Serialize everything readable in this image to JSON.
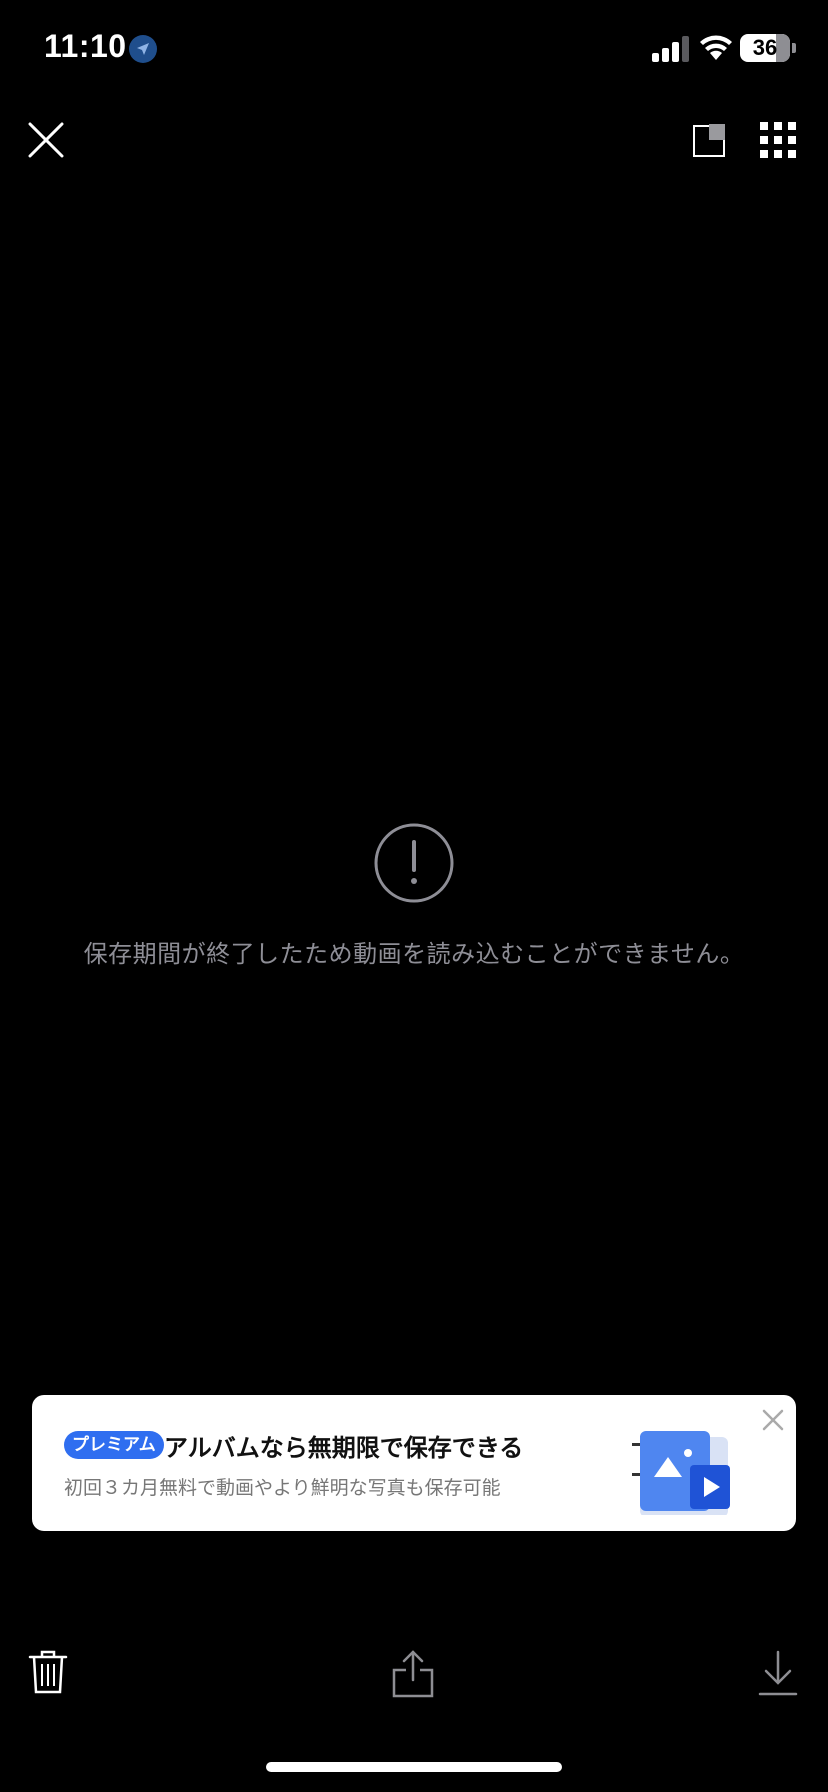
{
  "status_bar": {
    "time": "11:10",
    "battery": "36"
  },
  "viewer": {
    "error_message": "保存期間が終了したため動画を読み込むことができません。"
  },
  "promo": {
    "badge": "プレミアム",
    "title": "アルバムなら無期限で保存できる",
    "subtitle": "初回３カ月無料で動画やより鮮明な写真も保存可能"
  },
  "icons": {
    "close": "close-icon",
    "pip": "picture-in-picture-icon",
    "grid": "grid-icon",
    "alert": "exclamation-circle-icon",
    "trash": "trash-icon",
    "share": "share-icon",
    "download": "download-icon"
  },
  "colors": {
    "accent": "#2f6ef0",
    "error_text": "#8e8e96",
    "background": "#000000"
  }
}
